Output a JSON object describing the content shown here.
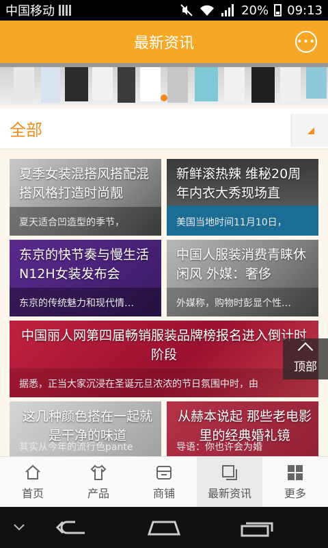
{
  "status": {
    "carrier": "中国移动",
    "battery": "20%",
    "time": "09:13"
  },
  "header": {
    "title": "最新资讯",
    "chat_icon": "chat-bubble-icon"
  },
  "filter": {
    "label": "全部"
  },
  "news": [
    {
      "title": "夏季女装混搭风搭配混搭风格打造时尚靓",
      "desc": "夏天适合凹造型的季节，"
    },
    {
      "title": "新鲜滚热辣 维秘20周年内衣大秀现场直",
      "desc": "美国当地时间11月10日，"
    },
    {
      "title": "东京的快节奏与慢生活 N12H女装发布会",
      "desc": "东京的传统魅力和现代情…"
    },
    {
      "title": "中国人服装消费青睐休闲风 外媒：奢侈",
      "desc": "外媒称，购物时彭显个性…"
    },
    {
      "title": "中国丽人网第四届畅销服装品牌榜报名进入倒计时阶段",
      "desc": "据悉，正当大家沉浸在圣诞元旦浓浓的节日氛围中时，由"
    },
    {
      "title": "这几种颜色搭在一起就是干净的味道",
      "desc": "其实从今年的流行色pante"
    },
    {
      "title": "从赫本说起 那些老电影里的经典婚礼镜",
      "desc": "导语：你也许会为婚"
    }
  ],
  "back_to_top": "顶部",
  "tabs": [
    {
      "label": "首页",
      "icon": "home-icon"
    },
    {
      "label": "产品",
      "icon": "shirt-icon"
    },
    {
      "label": "商铺",
      "icon": "store-icon"
    },
    {
      "label": "最新资讯",
      "icon": "news-icon",
      "active": true
    },
    {
      "label": "更多",
      "icon": "grid-icon"
    }
  ],
  "colors": {
    "accent": "#f6a723",
    "filter_text": "#f28c1a"
  }
}
